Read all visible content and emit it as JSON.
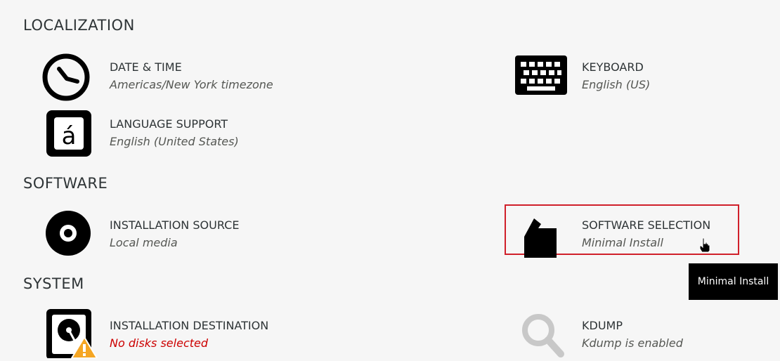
{
  "sections": {
    "localization": "LOCALIZATION",
    "software": "SOFTWARE",
    "system": "SYSTEM"
  },
  "spokes": {
    "date_time": {
      "title": "DATE & TIME",
      "status": "Americas/New York timezone",
      "icon": "clock-icon"
    },
    "keyboard": {
      "title": "KEYBOARD",
      "status": "English (US)",
      "icon": "keyboard-icon"
    },
    "language_support": {
      "title": "LANGUAGE SUPPORT",
      "status": "English (United States)",
      "icon": "language-icon"
    },
    "installation_source": {
      "title": "INSTALLATION SOURCE",
      "status": "Local media",
      "icon": "disc-icon"
    },
    "software_selection": {
      "title": "SOFTWARE SELECTION",
      "status": "Minimal Install",
      "icon": "package-icon"
    },
    "installation_destination": {
      "title": "INSTALLATION DESTINATION",
      "status": "No disks selected",
      "icon": "hard-drive-icon"
    },
    "kdump": {
      "title": "KDUMP",
      "status": "Kdump is enabled",
      "icon": "search-icon"
    }
  },
  "tooltip": {
    "text": "Minimal Install"
  },
  "colors": {
    "warning": "#cc0000",
    "highlight": "#d0202a",
    "tooltip_bg": "#000000"
  }
}
